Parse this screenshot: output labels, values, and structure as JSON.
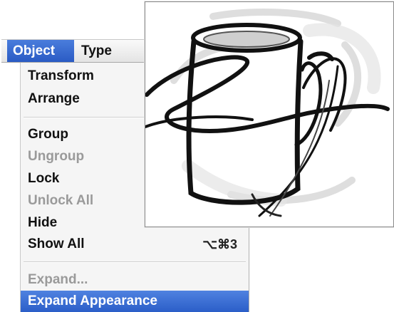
{
  "menubar": {
    "items": [
      {
        "label": "Object",
        "active": true
      },
      {
        "label": "Type",
        "active": false
      }
    ]
  },
  "menu": {
    "items": [
      {
        "label": "Transform",
        "enabled": true
      },
      {
        "label": "Arrange",
        "enabled": true
      },
      {
        "label": "Group",
        "enabled": true
      },
      {
        "label": "Ungroup",
        "enabled": false
      },
      {
        "label": "Lock",
        "enabled": true
      },
      {
        "label": "Unlock All",
        "enabled": false
      },
      {
        "label": "Hide",
        "enabled": true
      },
      {
        "label": "Show All",
        "enabled": true,
        "shortcut": "⌥⌘3"
      },
      {
        "label": "Expand...",
        "enabled": false
      },
      {
        "label": "Expand Appearance",
        "enabled": true,
        "selected": true
      }
    ]
  },
  "artwork": {
    "subject": "coffee-cup-drawing-icon"
  },
  "colors": {
    "menu_highlight": "#2b5ec8",
    "disabled_text": "#9a9a9a"
  }
}
